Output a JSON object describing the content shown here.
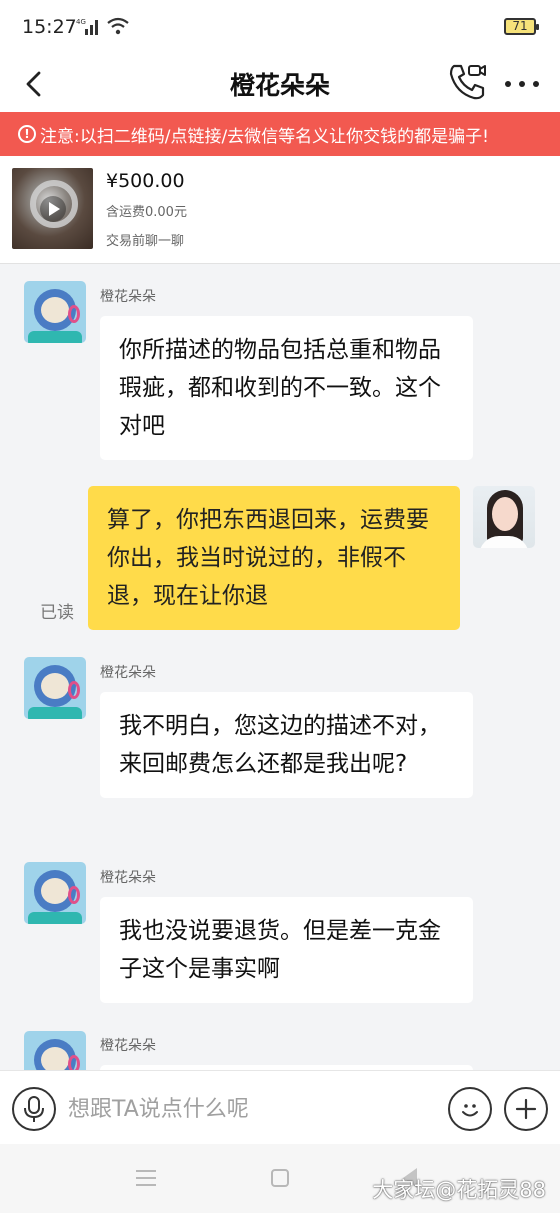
{
  "status_bar": {
    "time": "15:27",
    "battery": "71"
  },
  "header": {
    "title": "橙花朵朵"
  },
  "warning": {
    "text": "注意:以扫二维码/点链接/去微信等名义让你交钱的都是骗子!"
  },
  "product": {
    "price": "¥500.00",
    "shipping": "含运费0.00元",
    "pre_chat": "交易前聊一聊"
  },
  "messages": [
    {
      "sender": "橙花朵朵",
      "text": "你所描述的物品包括总重和物品瑕疵，都和收到的不一致。这个对吧"
    },
    {
      "status": "已读",
      "text": "算了，你把东西退回来，运费要你出，我当时说过的，非假不退，现在让你退"
    },
    {
      "sender": "橙花朵朵",
      "text": "我不明白，您这边的描述不对，来回邮费怎么还都是我出呢?"
    },
    {
      "sender": "橙花朵朵",
      "text": "我也没说要退货。但是差一克金子这个是事实啊"
    },
    {
      "sender": "橙花朵朵",
      "text": ""
    }
  ],
  "input": {
    "placeholder": "想跟TA说点什么呢"
  },
  "watermark": "大家坛@花拓灵88",
  "colors": {
    "warning_bg": "#f25950",
    "outgoing_bubble": "#ffdb4a",
    "chat_bg": "#f3f4f6"
  }
}
